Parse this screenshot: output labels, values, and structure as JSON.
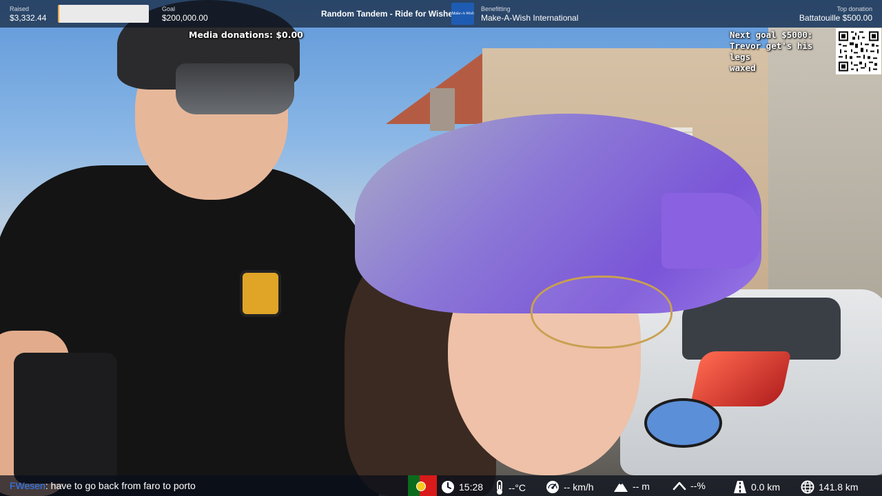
{
  "stream": {
    "raised_label": "Raised",
    "raised_value": "$3,332.44",
    "goal_label": "Goal",
    "goal_value": "$200,000.00",
    "progress_fraction": 0.017,
    "event_title": "Random Tandem - Ride for Wishes",
    "benefitting_label": "Benefitting",
    "benefitting_value": "Make-A-Wish International",
    "logo_text": "Make-A-Wish",
    "top_donation_label": "Top donation",
    "top_donation_value": "Battatouille $500.00"
  },
  "overlays": {
    "media_donations": "Media donations: $0.00",
    "next_goal_line1": "Next goal $5000:",
    "next_goal_line2": "Trevor get's his legs",
    "next_goal_line3": "waxed"
  },
  "chat": {
    "username": "FWesen",
    "separator": ":",
    "message": "have to go back from faro to porto"
  },
  "telemetry": {
    "time": "15:28",
    "temperature": "--°C",
    "speed": "-- km/h",
    "elevation": "-- m",
    "grade": "--%",
    "trip_distance": "0.0 km",
    "total_distance": "141.8 km"
  },
  "icons": {
    "flag": "portugal-flag-icon",
    "clock": "clock-icon",
    "thermometer": "thermometer-icon",
    "speed": "speedometer-icon",
    "elevation": "mountain-icon",
    "grade": "incline-icon",
    "trip": "road-icon",
    "globe": "globe-icon"
  },
  "colors": {
    "progress_fill": "#f3a33b",
    "chat_username": "#2e7dff",
    "brand_blue": "#1e5cb3"
  }
}
